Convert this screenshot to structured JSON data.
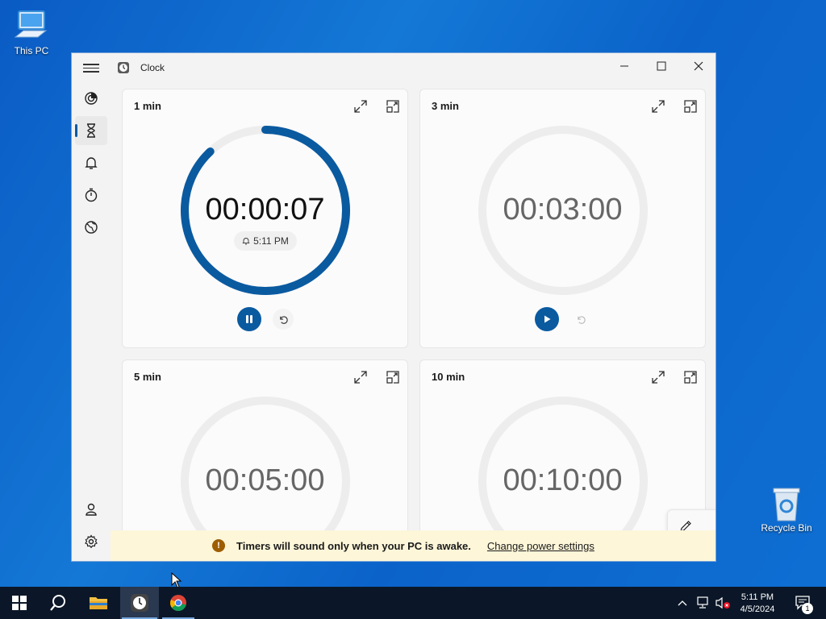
{
  "desktop": {
    "icons": [
      {
        "label": "This PC"
      },
      {
        "label": "Recycle Bin"
      }
    ]
  },
  "window": {
    "title": "Clock",
    "controls": {
      "minimize": "—",
      "maximize": "☐",
      "close": "✕"
    }
  },
  "nav": {
    "items": [
      "focus-sessions",
      "timer",
      "alarm",
      "stopwatch",
      "world-clock"
    ],
    "active": "timer",
    "bottom": [
      "account",
      "settings"
    ]
  },
  "timers": [
    {
      "title": "1 min",
      "time": "00:00:07",
      "running": true,
      "alarm_time": "5:11 PM",
      "progress": 0.88
    },
    {
      "title": "3 min",
      "time": "00:03:00",
      "running": false,
      "progress": 0
    },
    {
      "title": "5 min",
      "time": "00:05:00",
      "running": false,
      "progress": 0
    },
    {
      "title": "10 min",
      "time": "00:10:00",
      "running": false,
      "progress": 0
    }
  ],
  "infobar": {
    "message": "Timers will sound only when your PC is awake.",
    "link": "Change power settings"
  },
  "tray": {
    "time": "5:11 PM",
    "date": "4/5/2024",
    "notification_count": "1"
  },
  "colors": {
    "accent": "#0a5aa0",
    "infobar": "#fdf6d9"
  }
}
